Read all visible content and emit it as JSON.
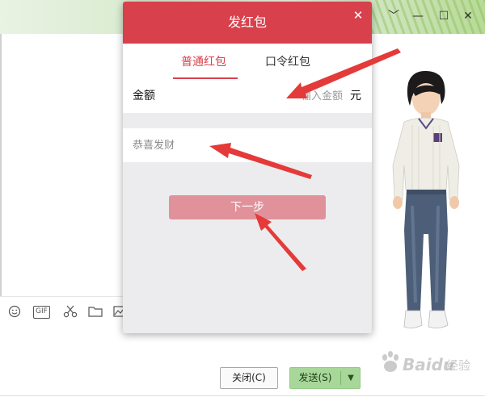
{
  "dialog": {
    "title": "发红包",
    "close_glyph": "✕",
    "tabs": [
      {
        "label": "普通红包",
        "active": true
      },
      {
        "label": "口令红包",
        "active": false
      }
    ],
    "amount": {
      "label": "金额",
      "placeholder": "输入金额",
      "unit": "元"
    },
    "greeting": {
      "placeholder": "恭喜发财"
    },
    "next_button": "下一步"
  },
  "chat": {
    "window_controls": [
      "﹀",
      "—",
      "☐",
      "✕"
    ],
    "toolbar_icons": [
      "emoji-icon",
      "gif-icon",
      "scissors-icon",
      "folder-icon",
      "image-icon"
    ],
    "gif_label": "GIF",
    "close_button": "关闭(C)",
    "send_button": "发送(S)",
    "send_dropdown_glyph": "▼"
  },
  "watermark": {
    "brand": "Baidu",
    "sub": "经验"
  },
  "colors": {
    "header_red": "#d8404c",
    "next_button": "#e1919a",
    "send_green": "#a8d79a",
    "arrow_red": "#e43a3a"
  }
}
